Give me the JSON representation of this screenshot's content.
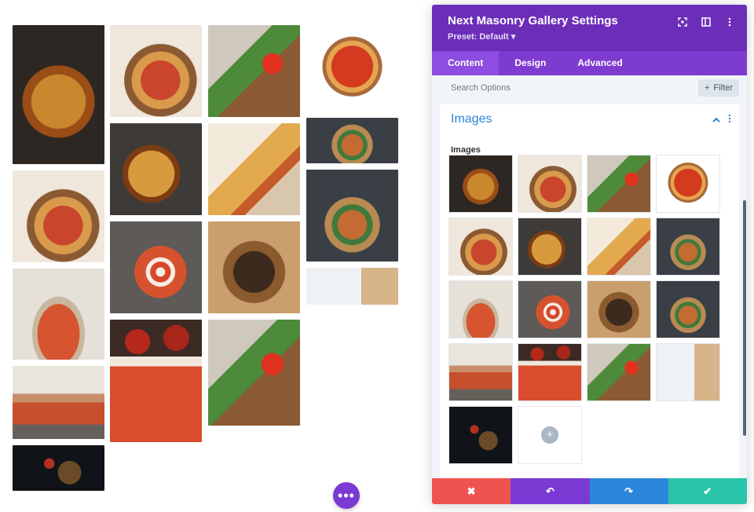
{
  "panel": {
    "title": "Next Masonry Gallery Settings",
    "preset": "Preset: Default ▾",
    "tabs": [
      {
        "label": "Content",
        "active": true
      },
      {
        "label": "Design",
        "active": false
      },
      {
        "label": "Advanced",
        "active": false
      }
    ],
    "search_placeholder": "Search Options",
    "filter_label": "Filter",
    "section_title": "Images",
    "field_label": "Images",
    "colors": {
      "header": "#6c2eb9",
      "tabs": "#7e3bd0",
      "section": "#2b87da",
      "cancel": "#ef5350",
      "undo": "#7b3ad4",
      "redo": "#2b87da",
      "save": "#29c4a9"
    },
    "actions": {
      "cancel": "✖",
      "undo": "↶",
      "redo": "↷",
      "save": "✔"
    }
  },
  "fab_label": "•••",
  "header_icons": [
    "focus-icon",
    "layout-icon",
    "more-vertical-icon"
  ]
}
